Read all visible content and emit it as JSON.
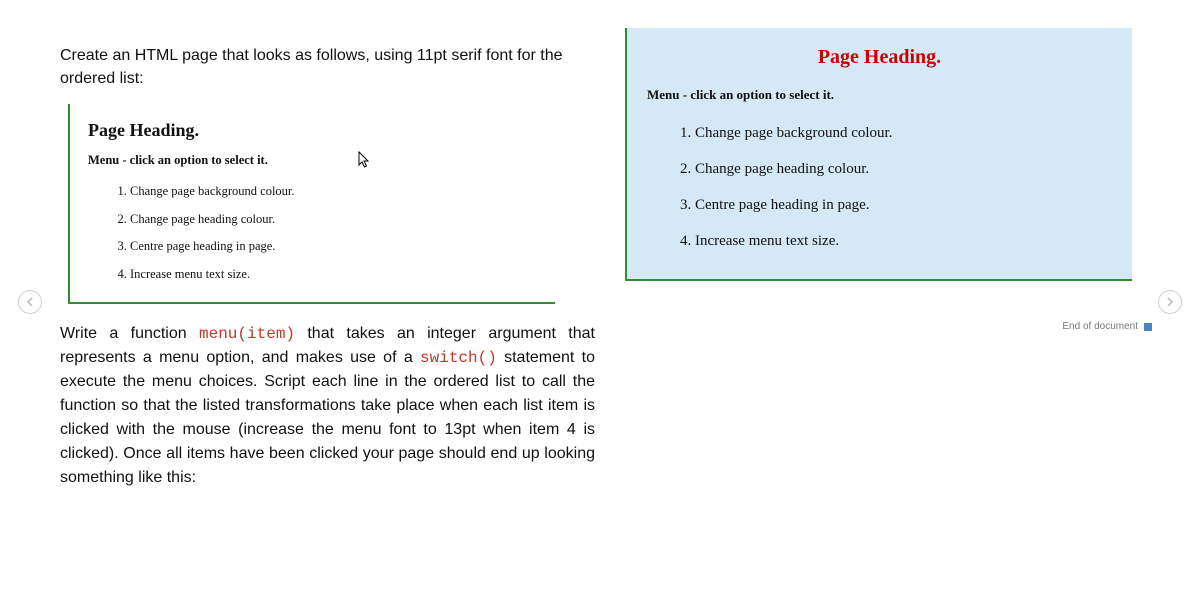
{
  "intro": "Create an HTML page that looks as follows, using 11pt serif font for the ordered list:",
  "before": {
    "heading": "Page Heading.",
    "menu_label": "Menu - click an option to select it.",
    "items": [
      "Change page background colour.",
      "Change page heading colour.",
      "Centre page heading in page.",
      "Increase menu text size."
    ]
  },
  "body_parts": {
    "p1a": "Write a function ",
    "code1": "menu(item)",
    "p1b": " that takes an integer argu­ment that represents a menu option, and makes use of a ",
    "code2": "switch()",
    "p1c": " statement to execute the menu choices. Script each line in the ordered list to call the function so that the listed transformations take place when each list item is clicked with the mouse (increase the menu font to 13pt when item 4 is clicked). Once all items have been clicked your page should end up looking something like this:"
  },
  "after": {
    "heading": "Page Heading.",
    "menu_label": "Menu - click an option to select it.",
    "items": [
      "Change page background colour.",
      "Change page heading colour.",
      "Centre page heading in page.",
      "Increase menu text size."
    ]
  },
  "footer": "End of document"
}
